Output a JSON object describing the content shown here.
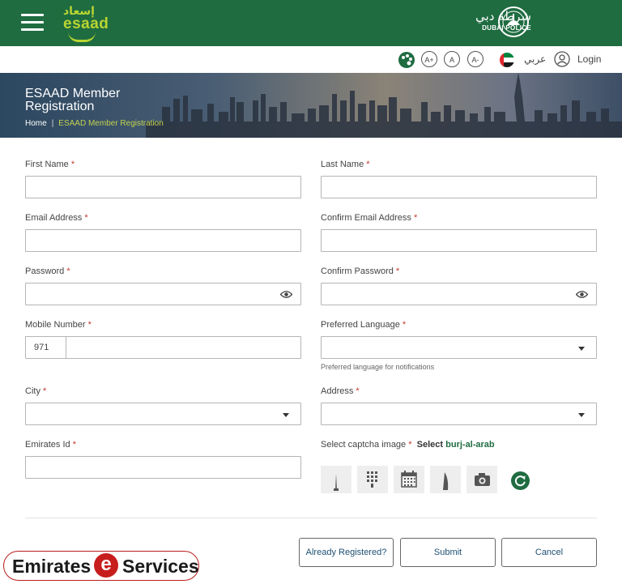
{
  "header": {
    "logo_arabic": "إسعاد",
    "logo_text": "esaad",
    "police_arabic": "شرطة دبي",
    "police_english": "DUBAI POLICE",
    "brand_color": "#1f6c41",
    "accent_color": "#b9d531"
  },
  "utility": {
    "font_increase": "A+",
    "font_reset": "A",
    "font_decrease": "A-",
    "language": "عربي",
    "login": "Login"
  },
  "hero": {
    "title": "ESAAD Member Registration",
    "breadcrumb": [
      "Home",
      "ESAAD Member Registration"
    ],
    "breadcrumb_separator": "|"
  },
  "form": {
    "first_name_label": "First Name",
    "last_name_label": "Last Name",
    "email_label": "Email Address",
    "confirm_email_label": "Confirm Email Address",
    "password_label": "Password",
    "confirm_password_label": "Confirm Password",
    "mobile_label": "Mobile Number",
    "mobile_prefix": "971",
    "preferred_language_label": "Preferred Language",
    "preferred_language_hint": "Preferred language for notifications",
    "city_label": "City",
    "address_label": "Address",
    "emirates_id_label": "Emirates Id",
    "captcha_label": "Select captcha image",
    "captcha_select": "Select",
    "captcha_target": "burj-al-arab",
    "required_mark": "*"
  },
  "captcha_icons": [
    "tower-icon",
    "building-grid-icon",
    "calendar-icon",
    "burj-al-arab-icon",
    "camera-icon"
  ],
  "buttons": {
    "already_registered": "Already Registered?",
    "submit": "Submit",
    "cancel": "Cancel"
  },
  "watermark": {
    "part1": "Emirates",
    "e": "e",
    "part2": "Services"
  }
}
